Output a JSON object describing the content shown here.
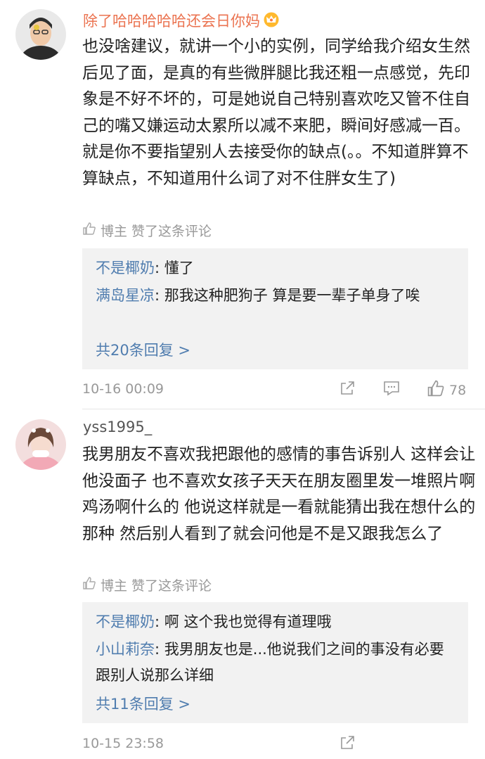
{
  "comments": [
    {
      "username": "除了哈哈哈哈哈还会日你妈",
      "text": "也没啥建议，就讲一个小的实例，同学给我介绍女生然后见了面，是真的有些微胖腿比我还粗一点感觉，先印象是不好不坏的，可是她说自己特别喜欢吃又管不住自己的嘴又嫌运动太累所以减不来肥，瞬间好感减一百。就是你不要指望别人去接受你的缺点(。。不知道胖算不算缺点，不知道用什么词了对不住胖女生了)",
      "liked_by": "博主 赞了这条评论",
      "replies": [
        {
          "name": "不是椰奶",
          "text": "懂了"
        },
        {
          "name": "满岛星凉",
          "text": "那我这种肥狗子 算是要一辈子单身了唉"
        }
      ],
      "more_replies": "共20条回复 >",
      "timestamp": "10-16 00:09",
      "like_count": "78"
    },
    {
      "username": "yss1995_",
      "text": "我男朋友不喜欢我把跟他的感情的事告诉别人 这样会让他没面子 也不喜欢女孩子天天在朋友圈里发一堆照片啊 鸡汤啊什么的 他说这样就是一看就能猜出我在想什么的那种 然后别人看到了就会问他是不是又跟我怎么了",
      "liked_by": "博主 赞了这条评论",
      "replies": [
        {
          "name": "不是椰奶",
          "text": "啊 这个我也觉得有道理哦"
        },
        {
          "name": "小山莉奈",
          "text": "我男朋友也是...他说我们之间的事没有必要跟别人说那么详细"
        }
      ],
      "more_replies": "共11条回复 >",
      "timestamp": "10-15 23:58"
    }
  ],
  "icons": {
    "crown": "crown-icon",
    "thumb": "thumb-up-icon",
    "share": "share-icon",
    "comment": "comment-icon"
  },
  "colors": {
    "vip_name": "#eb7350",
    "reply_name": "#507daf",
    "meta": "#999999",
    "reply_bg": "#f2f2f2"
  }
}
